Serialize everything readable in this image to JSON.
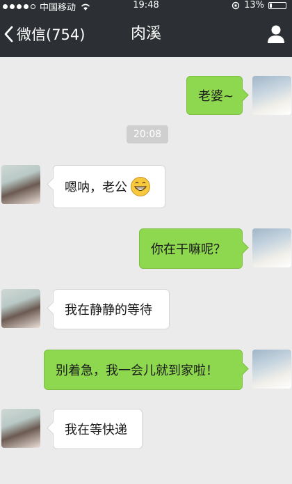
{
  "status": {
    "carrier": "中国移动",
    "time": "19:48",
    "battery": "13%",
    "battery_level": 0.13
  },
  "nav": {
    "back_label": "微信(754)",
    "title": "肉溪"
  },
  "chat": {
    "timestamp": "20:08",
    "messages": [
      {
        "from": "me",
        "text": "老婆~"
      },
      {
        "from": "her",
        "text": "嗯呐，老公",
        "emoji": "grinning-face"
      },
      {
        "from": "me",
        "text": "你在干嘛呢？"
      },
      {
        "from": "her",
        "text": "我在静静的等待"
      },
      {
        "from": "me",
        "text": "别着急，我一会儿就到家啦！"
      },
      {
        "from": "her",
        "text": "我在等快递"
      }
    ]
  },
  "colors": {
    "bar": "#2c2f33",
    "background": "#ebebeb",
    "out_bubble": "#8ed84f",
    "in_bubble": "#ffffff"
  }
}
